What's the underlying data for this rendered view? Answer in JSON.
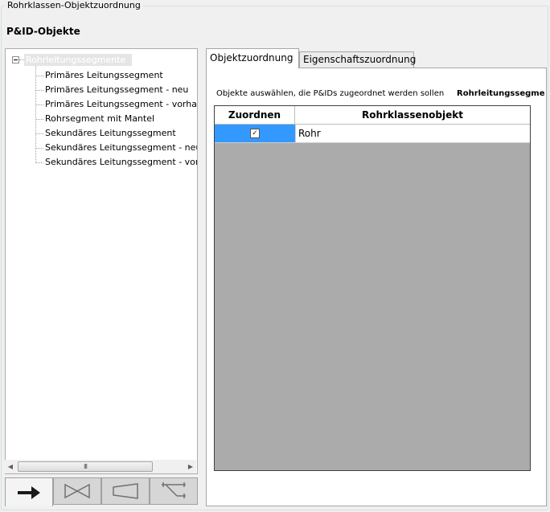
{
  "group_title": "Rohrklassen-Objektzuordnung",
  "section_title": "P&ID-Objekte",
  "tree": {
    "root_label": "Rohrleitungssegmente",
    "items": [
      "Primäres Leitungssegment",
      "Primäres Leitungssegment - neu",
      "Primäres Leitungssegment - vorhanden",
      "Rohrsegment mit Mantel",
      "Sekundäres Leitungssegment",
      "Sekundäres Leitungssegment - neu",
      "Sekundäres Leitungssegment - vorhanden"
    ]
  },
  "scrollbar": {
    "thumb_grip": "III"
  },
  "tool_tabs": [
    "arrow-right-icon",
    "valve-icon",
    "reducer-icon",
    "fitting-icon"
  ],
  "tabs": {
    "objektzuordnung": "Objektzuordnung",
    "eigenschaftszuordnung": "Eigenschaftszuordnung"
  },
  "tab_page": {
    "description": "Objekte auswählen, die P&IDs zugeordnet werden sollen",
    "reference": "Rohrleitungssegmente"
  },
  "grid": {
    "col_assign": "Zuordnen",
    "col_object": "Rohrklassenobjekt",
    "rows": [
      {
        "checked": true,
        "check_glyph": "✓",
        "object": "Rohr"
      }
    ]
  },
  "colors": {
    "selection": "#3399ff",
    "grid_background": "#ababab"
  }
}
